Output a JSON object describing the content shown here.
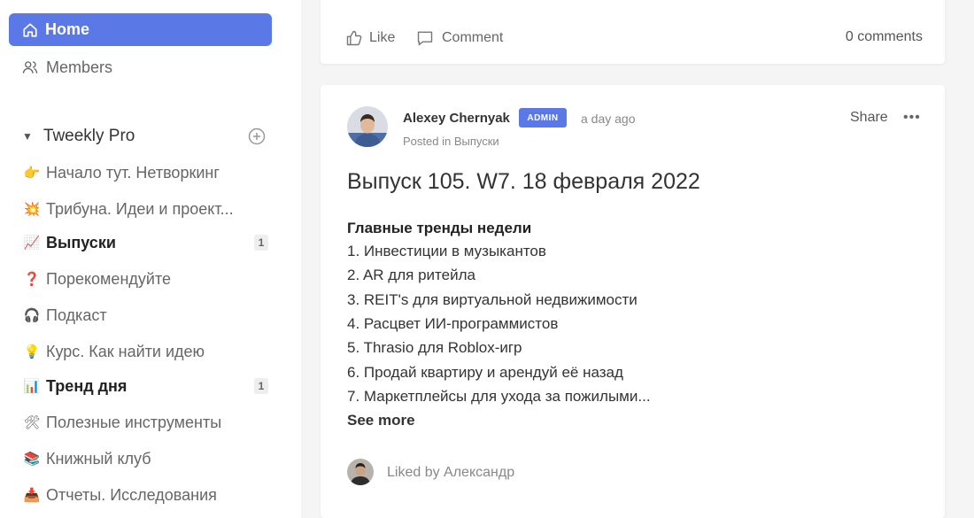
{
  "sidebar": {
    "home_label": "Home",
    "members_label": "Members",
    "group": {
      "title": "Tweekly Pro"
    },
    "channels": [
      {
        "emoji": "👉",
        "label": "Начало тут. Нетворкинг",
        "bold": false,
        "badge": ""
      },
      {
        "emoji": "💥",
        "label": "Трибуна. Идеи и проект...",
        "bold": false,
        "badge": ""
      },
      {
        "emoji": "📈",
        "label": "Выпуски",
        "bold": true,
        "badge": "1"
      },
      {
        "emoji": "❓",
        "label": "Порекомендуйте",
        "bold": false,
        "badge": ""
      },
      {
        "emoji": "🎧",
        "label": "Подкаст",
        "bold": false,
        "badge": ""
      },
      {
        "emoji": "💡",
        "label": "Курс. Как найти идею",
        "bold": false,
        "badge": ""
      },
      {
        "emoji": "📊",
        "label": "Тренд дня",
        "bold": true,
        "badge": "1"
      },
      {
        "emoji": "🛠",
        "label": "Полезные инструменты",
        "bold": false,
        "badge": ""
      },
      {
        "emoji": "📚",
        "label": "Книжный клуб",
        "bold": false,
        "badge": ""
      },
      {
        "emoji": "📥",
        "label": "Отчеты. Исследования",
        "bold": false,
        "badge": ""
      }
    ]
  },
  "top_card": {
    "like_label": "Like",
    "comment_label": "Comment",
    "comments_count": "0 comments"
  },
  "post": {
    "author": "Alexey Chernyak",
    "badge": "ADMIN",
    "time": "a day ago",
    "posted_in": "Posted in Выпуски",
    "share_label": "Share",
    "more_label": "•••",
    "title": "Выпуск 105. W7. 18 февраля 2022",
    "trends_heading": "Главные тренды недели",
    "trends": [
      "1. Инвестиции в музыкантов",
      "2. AR для ритейла",
      "3. REIT's для виртуальной недвижимости",
      "4. Расцвет ИИ-программистов",
      "5. Thrasio для Roblox-игр",
      "6. Продай квартиру и арендуй её назад",
      "7. Маркетплейсы для ухода за пожилыми..."
    ],
    "see_more": "See more",
    "liked_by": "Liked by Александр"
  },
  "colors": {
    "accent": "#5a78e6"
  }
}
